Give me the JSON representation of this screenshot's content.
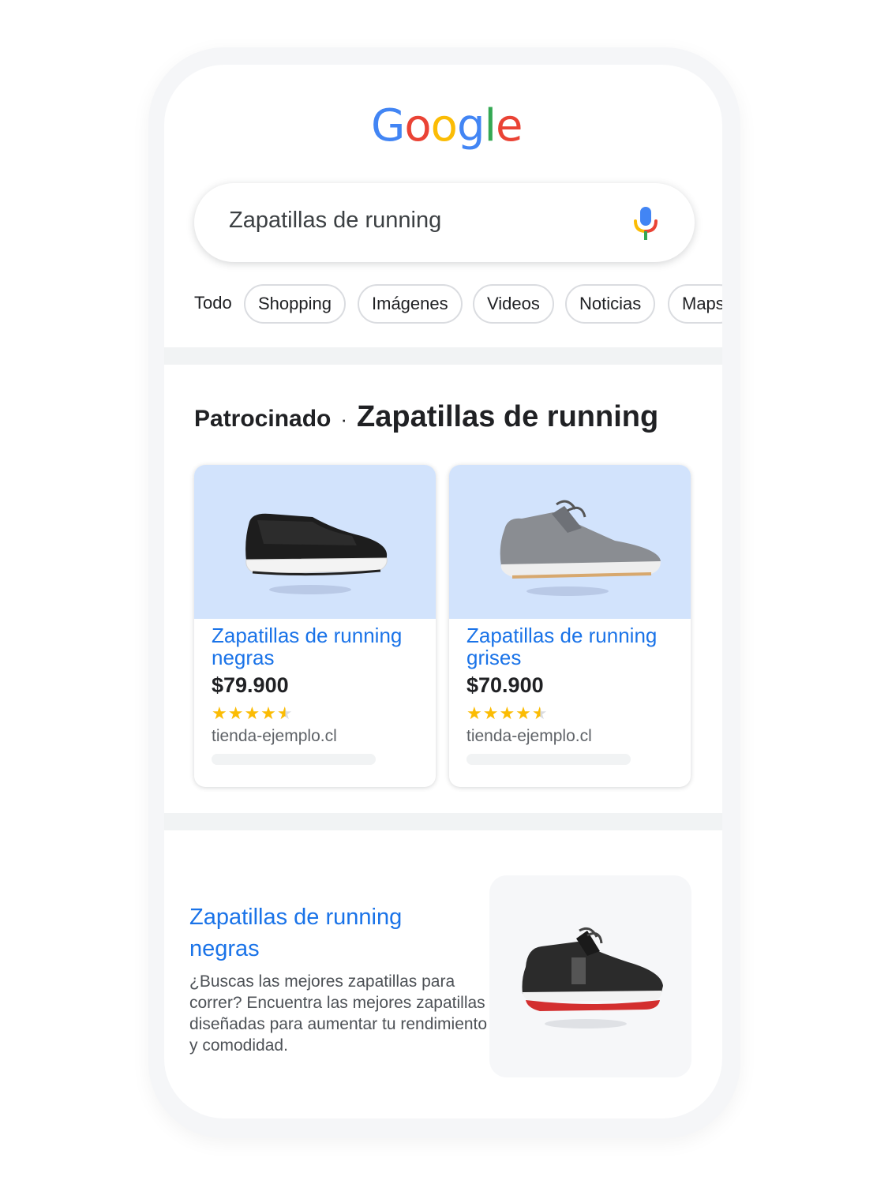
{
  "logo": {
    "letters": [
      "G",
      "o",
      "o",
      "g",
      "l",
      "e"
    ],
    "colors": [
      "#4285F4",
      "#EA4335",
      "#FBBC05",
      "#4285F4",
      "#34A853",
      "#EA4335"
    ]
  },
  "search": {
    "query": "Zapatillas de running",
    "mic_icon": "microphone-icon"
  },
  "tabs": {
    "plain": "Todo",
    "chips": [
      "Shopping",
      "Imágenes",
      "Videos",
      "Noticias",
      "Maps"
    ]
  },
  "sponsored": {
    "label": "Patrocinado",
    "separator": "·",
    "title": "Zapatillas de running",
    "products": [
      {
        "title": "Zapatillas de running negras",
        "price": "$79.900",
        "rating": 4.5,
        "store": "tienda-ejemplo.cl",
        "image_icon": "black-running-shoe-icon"
      },
      {
        "title": "Zapatillas de running grises",
        "price": "$70.900",
        "rating": 4.5,
        "store": "tienda-ejemplo.cl",
        "image_icon": "gray-running-shoe-icon"
      }
    ]
  },
  "organic": {
    "title": "Zapatillas de running negras",
    "description": "¿Buscas las mejores zapatillas para correr? Encuentra las mejores zapatillas diseñadas para aumentar tu rendimiento y comodidad.",
    "image_icon": "black-red-running-shoe-icon"
  },
  "colors": {
    "link": "#1a73e8",
    "star": "#fbbc04",
    "card_bg": "#d2e3fc"
  }
}
